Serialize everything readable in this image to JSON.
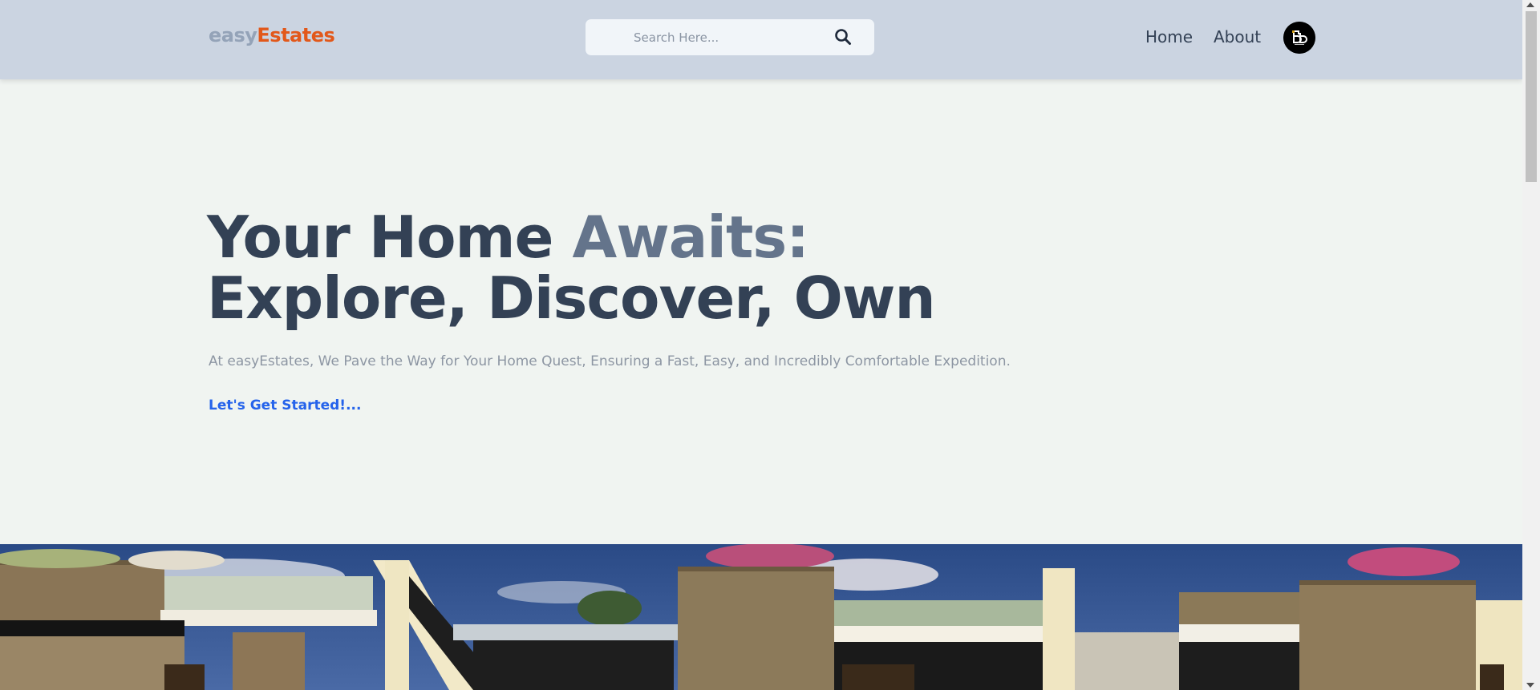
{
  "header": {
    "logo_part1": "easy",
    "logo_part2": "Estates",
    "search_placeholder": "Search Here...",
    "nav": {
      "home": "Home",
      "about": "About"
    },
    "avatar_icon": "user-avatar-icon"
  },
  "hero": {
    "title_part1": "Your Home ",
    "title_accent": "Awaits:",
    "title_line2": "Explore, Discover, Own",
    "subtitle": "At easyEstates, We Pave the Way for Your Home Quest, Ensuring a Fast, Easy, and Incredibly Comfortable Expedition.",
    "cta": "Let's Get Started!..."
  },
  "colors": {
    "header_bg": "#cbd4e1",
    "page_bg": "#f0f4f1",
    "brand_orange": "#e2581a",
    "brand_gray": "#94a3b8",
    "heading": "#334155",
    "accent": "#64748b",
    "link": "#2563eb"
  }
}
